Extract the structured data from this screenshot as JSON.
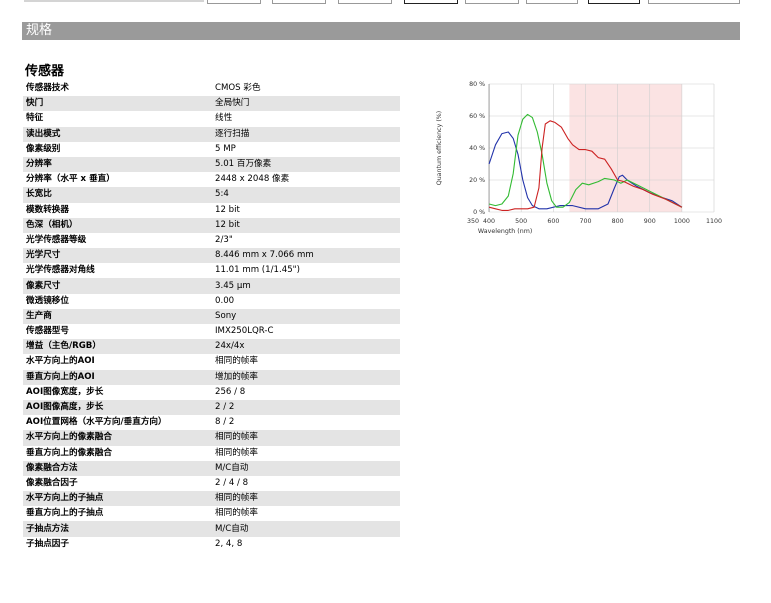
{
  "section_title": "规格",
  "table": {
    "title": "传感器",
    "rows": [
      {
        "label": "传感器技术",
        "value": "CMOS 彩色"
      },
      {
        "label": "快门",
        "value": "全局快门"
      },
      {
        "label": "特征",
        "value": "线性"
      },
      {
        "label": "读出模式",
        "value": "逐行扫描"
      },
      {
        "label": "像素级别",
        "value": "5 MP"
      },
      {
        "label": "分辨率",
        "value": "5.01 百万像素"
      },
      {
        "label": "分辨率（水平 x 垂直）",
        "value": "2448 x 2048 像素"
      },
      {
        "label": "长宽比",
        "value": "5:4"
      },
      {
        "label": "模数转换器",
        "value": "12 bit"
      },
      {
        "label": "色深（相机）",
        "value": "12 bit"
      },
      {
        "label": "光学传感器等级",
        "value": "2/3\""
      },
      {
        "label": "光学尺寸",
        "value": "8.446 mm x 7.066 mm"
      },
      {
        "label": "光学传感器对角线",
        "value": "11.01 mm (1/1.45\")"
      },
      {
        "label": "像素尺寸",
        "value": "3.45 µm"
      },
      {
        "label": "微透镜移位",
        "value": "0.00"
      },
      {
        "label": "生产商",
        "value": "Sony"
      },
      {
        "label": "传感器型号",
        "value": "IMX250LQR-C"
      },
      {
        "label": "增益（主色/RGB）",
        "value": "24x/4x"
      },
      {
        "label": "水平方向上的AOI",
        "value": "相同的帧率"
      },
      {
        "label": "垂直方向上的AOI",
        "value": "增加的帧率"
      },
      {
        "label": "AOI图像宽度，步长",
        "value": "256 / 8"
      },
      {
        "label": "AOI图像高度，步长",
        "value": "2 / 2"
      },
      {
        "label": "AOI位置网格（水平方向/垂直方向）",
        "value": "8 / 2"
      },
      {
        "label": "水平方向上的像素融合",
        "value": "相同的帧率"
      },
      {
        "label": "垂直方向上的像素融合",
        "value": "相同的帧率"
      },
      {
        "label": "像素融合方法",
        "value": "M/C自动"
      },
      {
        "label": "像素融合因子",
        "value": "2 / 4 / 8"
      },
      {
        "label": "水平方向上的子抽点",
        "value": "相同的帧率"
      },
      {
        "label": "垂直方向上的子抽点",
        "value": "相同的帧率"
      },
      {
        "label": "子抽点方法",
        "value": "M/C自动"
      },
      {
        "label": "子抽点因子",
        "value": "2, 4, 8"
      }
    ]
  },
  "chart_data": {
    "type": "line",
    "title": "",
    "xlabel": "Wavelength (nm)",
    "ylabel": "Quantum efficiency (%)",
    "xlim": [
      350,
      1100
    ],
    "ylim": [
      0,
      80
    ],
    "x_ticks": [
      350,
      400,
      500,
      600,
      700,
      800,
      900,
      1000,
      1100
    ],
    "x_tick_labels": [
      "350",
      "400",
      "500",
      "600",
      "700",
      "800",
      "900",
      "1000",
      "1100"
    ],
    "y_ticks": [
      0,
      20,
      40,
      60,
      80
    ],
    "y_tick_labels": [
      "0 %",
      "20 %",
      "40 %",
      "60 %",
      "80 %"
    ],
    "grid": true,
    "legend": "none",
    "shaded_region": {
      "x_from": 650,
      "x_to": 1000,
      "color": "#fbe3e3"
    },
    "series": [
      {
        "color": "#2233aa",
        "points": [
          [
            400,
            30
          ],
          [
            420,
            42
          ],
          [
            440,
            49
          ],
          [
            460,
            50
          ],
          [
            475,
            46
          ],
          [
            490,
            36
          ],
          [
            505,
            20
          ],
          [
            520,
            9
          ],
          [
            535,
            4
          ],
          [
            555,
            2
          ],
          [
            580,
            2
          ],
          [
            620,
            4
          ],
          [
            660,
            4
          ],
          [
            700,
            2
          ],
          [
            740,
            2
          ],
          [
            770,
            5
          ],
          [
            790,
            15
          ],
          [
            805,
            22
          ],
          [
            815,
            23
          ],
          [
            830,
            20
          ],
          [
            860,
            16
          ],
          [
            900,
            12
          ],
          [
            940,
            9
          ],
          [
            970,
            7
          ],
          [
            1000,
            3
          ]
        ]
      },
      {
        "color": "#33bb33",
        "points": [
          [
            400,
            5
          ],
          [
            420,
            4
          ],
          [
            440,
            5
          ],
          [
            460,
            10
          ],
          [
            475,
            24
          ],
          [
            490,
            48
          ],
          [
            505,
            58
          ],
          [
            520,
            61
          ],
          [
            535,
            59
          ],
          [
            550,
            50
          ],
          [
            565,
            36
          ],
          [
            580,
            18
          ],
          [
            595,
            7
          ],
          [
            610,
            3
          ],
          [
            630,
            3
          ],
          [
            650,
            6
          ],
          [
            670,
            14
          ],
          [
            690,
            18
          ],
          [
            710,
            17
          ],
          [
            740,
            19
          ],
          [
            760,
            21
          ],
          [
            790,
            20
          ],
          [
            810,
            18
          ],
          [
            830,
            20
          ],
          [
            860,
            17
          ],
          [
            900,
            13
          ],
          [
            940,
            9
          ],
          [
            970,
            6
          ],
          [
            1000,
            3
          ]
        ]
      },
      {
        "color": "#cc2222",
        "points": [
          [
            400,
            3
          ],
          [
            420,
            2
          ],
          [
            440,
            1
          ],
          [
            460,
            1
          ],
          [
            480,
            2
          ],
          [
            500,
            2
          ],
          [
            520,
            2
          ],
          [
            540,
            3
          ],
          [
            555,
            15
          ],
          [
            565,
            40
          ],
          [
            575,
            55
          ],
          [
            590,
            57
          ],
          [
            605,
            56
          ],
          [
            625,
            53
          ],
          [
            645,
            46
          ],
          [
            660,
            42
          ],
          [
            680,
            39
          ],
          [
            700,
            39
          ],
          [
            720,
            38
          ],
          [
            740,
            34
          ],
          [
            760,
            33
          ],
          [
            780,
            27
          ],
          [
            800,
            20
          ],
          [
            820,
            19
          ],
          [
            850,
            16
          ],
          [
            880,
            14
          ],
          [
            910,
            11
          ],
          [
            950,
            8
          ],
          [
            1000,
            3
          ]
        ]
      }
    ]
  }
}
